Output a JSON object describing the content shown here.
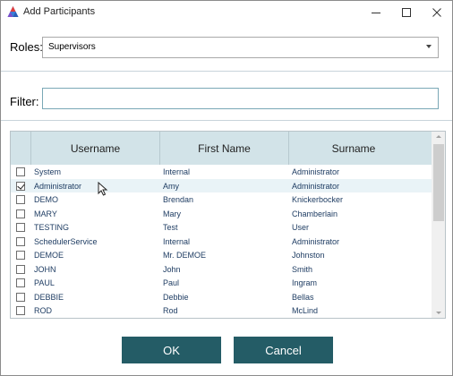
{
  "window": {
    "title": "Add Participants",
    "icon": "app-logo-icon",
    "controls": [
      "minimize-icon",
      "maximize-icon",
      "close-icon"
    ]
  },
  "roles": {
    "label": "Roles:",
    "selected": "Supervisors"
  },
  "filter": {
    "label": "Filter:",
    "value": "",
    "placeholder": ""
  },
  "grid": {
    "columns": [
      "Username",
      "First Name",
      "Surname"
    ],
    "rows": [
      {
        "checked": false,
        "username": "System",
        "first_name": "Internal",
        "surname": "Administrator"
      },
      {
        "checked": true,
        "username": "Administrator",
        "first_name": "Amy",
        "surname": "Administrator"
      },
      {
        "checked": false,
        "username": "DEMO",
        "first_name": "Brendan",
        "surname": "Knickerbocker"
      },
      {
        "checked": false,
        "username": "MARY",
        "first_name": "Mary",
        "surname": "Chamberlain"
      },
      {
        "checked": false,
        "username": "TESTING",
        "first_name": "Test",
        "surname": "User"
      },
      {
        "checked": false,
        "username": "SchedulerService",
        "first_name": "Internal",
        "surname": "Administrator"
      },
      {
        "checked": false,
        "username": "DEMOE",
        "first_name": "Mr. DEMOE",
        "surname": "Johnston"
      },
      {
        "checked": false,
        "username": "JOHN",
        "first_name": "John",
        "surname": "Smith"
      },
      {
        "checked": false,
        "username": "PAUL",
        "first_name": "Paul",
        "surname": "Ingram"
      },
      {
        "checked": false,
        "username": "DEBBIE",
        "first_name": "Debbie",
        "surname": "Bellas"
      },
      {
        "checked": false,
        "username": "ROD",
        "first_name": "Rod",
        "surname": "McLind"
      }
    ]
  },
  "buttons": {
    "ok": "OK",
    "cancel": "Cancel"
  },
  "colors": {
    "header_bg": "#d2e3e8",
    "button_bg": "#245c66",
    "cell_text": "#1f3d63"
  }
}
